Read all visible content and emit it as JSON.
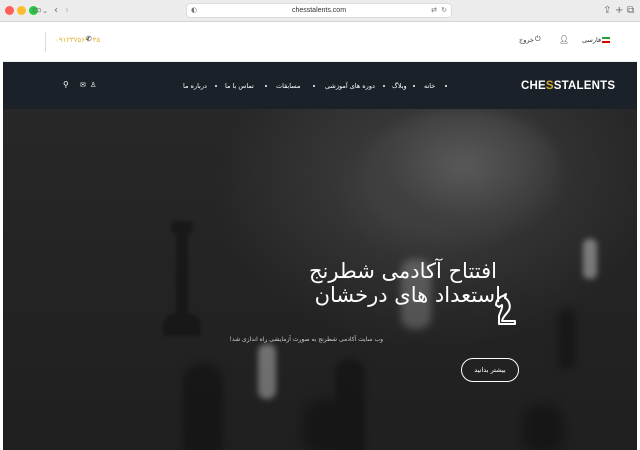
{
  "browser": {
    "url": "chesstalents.com",
    "icons": [
      "sidebar-icon",
      "back-icon",
      "forward-icon",
      "share-icon",
      "new-tab-icon",
      "tabs-icon"
    ]
  },
  "topbar": {
    "phone": "۰۹۱۲۳۷۵۶۹۰۴۵",
    "language": "فارسی",
    "logout": "خروج",
    "flag_colors": [
      "#239f40",
      "#ffffff",
      "#da0000"
    ]
  },
  "navbar": {
    "logo_left": "CHE",
    "logo_gold": "S",
    "logo_right": "STALENTS",
    "items": [
      "خانه",
      "وبلاگ",
      "دوره های آموزشی",
      "مسابقات",
      "تماس با ما",
      "درباره ما"
    ],
    "accent": "#d8a928",
    "background": "#1a2129"
  },
  "hero": {
    "title_line1": "افتتاح آکادمی شطرنج",
    "title_line2": "استعداد های درخشان",
    "subtitle": "وب سایت آکادمی شطرنج به صورت آزمایشی راه اندازی شد!",
    "button": "بیشتر بدانید"
  }
}
